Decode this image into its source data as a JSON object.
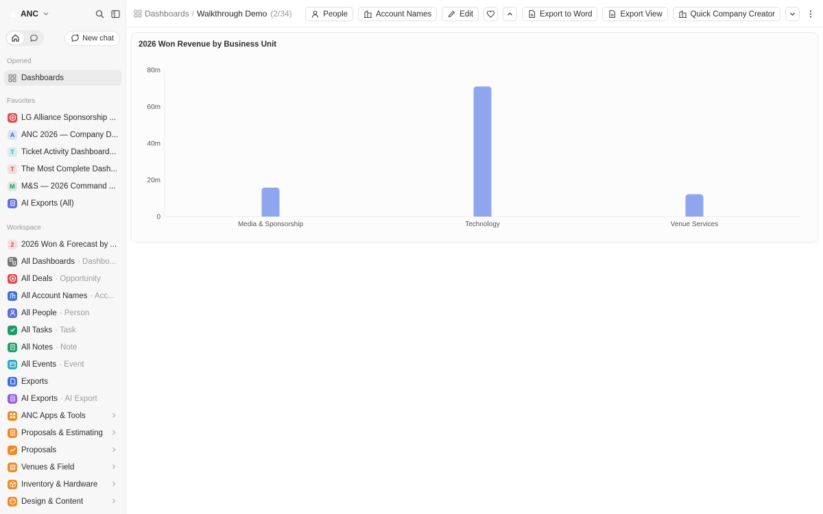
{
  "workspace": {
    "name": "ANC"
  },
  "sidebar": {
    "new_chat": "New chat",
    "opened_label": "Opened",
    "opened": [
      {
        "label": "Dashboards",
        "icon": "grid-icon"
      }
    ],
    "favorites_label": "Favorites",
    "favorites": [
      {
        "label": "LG Alliance Sponsorship ...",
        "icon": "target-icon",
        "color": "#e0474c"
      },
      {
        "label": "ANC 2026 — Company D...",
        "letter": "A",
        "color": "#2f6fdf"
      },
      {
        "label": "Ticket Activity Dashboard...",
        "letter": "T",
        "color": "#2aa6c9"
      },
      {
        "label": "The Most Complete Dash...",
        "letter": "T",
        "color": "#e0474c"
      },
      {
        "label": "M&S — 2026 Command ...",
        "letter": "M",
        "color": "#1f8f5b"
      },
      {
        "label": "AI Exports (All)",
        "icon": "ai-export-icon",
        "color": "#5b6fe0"
      }
    ],
    "workspace_label": "Workspace",
    "workspace_items": [
      {
        "label": "2026 Won & Forecast by ...",
        "letter": "2",
        "color": "#e0474c"
      },
      {
        "label": "All Dashboards",
        "sub": "· Dashbo...",
        "icon": "dashboards-icon",
        "color": "#777777"
      },
      {
        "label": "All Deals",
        "sub": "· Opportunity",
        "icon": "target-icon",
        "color": "#e0474c"
      },
      {
        "label": "All Account Names",
        "sub": "· Acc...",
        "icon": "building-icon",
        "color": "#3b6fe0"
      },
      {
        "label": "All People",
        "sub": "· Person",
        "icon": "person-icon",
        "color": "#5b6fe0"
      },
      {
        "label": "All Tasks",
        "sub": "· Task",
        "icon": "task-icon",
        "color": "#1f9b6b"
      },
      {
        "label": "All Notes",
        "sub": "· Note",
        "icon": "note-icon",
        "color": "#1f9b6b"
      },
      {
        "label": "All Events",
        "sub": "· Event",
        "icon": "event-icon",
        "color": "#2aa6c9"
      },
      {
        "label": "Exports",
        "icon": "export-icon",
        "color": "#3b6fe0"
      },
      {
        "label": "AI Exports",
        "sub": "· AI Export",
        "icon": "ai-export-icon",
        "color": "#9b5be0"
      },
      {
        "label": "ANC Apps & Tools",
        "icon": "apps-icon",
        "color": "#f08a24",
        "chevron": true
      },
      {
        "label": "Proposals & Estimating",
        "icon": "proposal-icon",
        "color": "#f08a24",
        "chevron": true
      },
      {
        "label": "Proposals",
        "icon": "chart-line-icon",
        "color": "#f08a24",
        "chevron": true
      },
      {
        "label": "Venues & Field",
        "icon": "venue-icon",
        "color": "#f08a24",
        "chevron": true
      },
      {
        "label": "Inventory & Hardware",
        "icon": "box-icon",
        "color": "#f08a24",
        "chevron": true
      },
      {
        "label": "Design & Content",
        "icon": "palette-icon",
        "color": "#f08a24",
        "chevron": true
      }
    ]
  },
  "topbar": {
    "crumb_root": "Dashboards",
    "crumb_sep": "/",
    "crumb_current": "Walkthrough Demo",
    "crumb_count": "(2/34)",
    "people": "People",
    "account_names": "Account Names",
    "edit": "Edit",
    "export_word": "Export to Word",
    "export_view": "Export View",
    "quick_company": "Quick Company Creator"
  },
  "chart_title": "2026 Won Revenue by Business Unit",
  "chart_data": {
    "type": "bar",
    "title": "2026 Won Revenue by Business Unit",
    "categories": [
      "Media & Sponsorship",
      "Technology",
      "Venue Services"
    ],
    "values": [
      15.8,
      71.0,
      12.2
    ],
    "ylim": [
      0,
      80
    ],
    "yticks": [
      0,
      20,
      40,
      60,
      80
    ],
    "ytick_labels": [
      "0",
      "20m",
      "40m",
      "60m",
      "80m"
    ],
    "xlabel": "",
    "ylabel": "",
    "grid": false,
    "legend": "none",
    "bar_color": "#8fa6ef"
  }
}
